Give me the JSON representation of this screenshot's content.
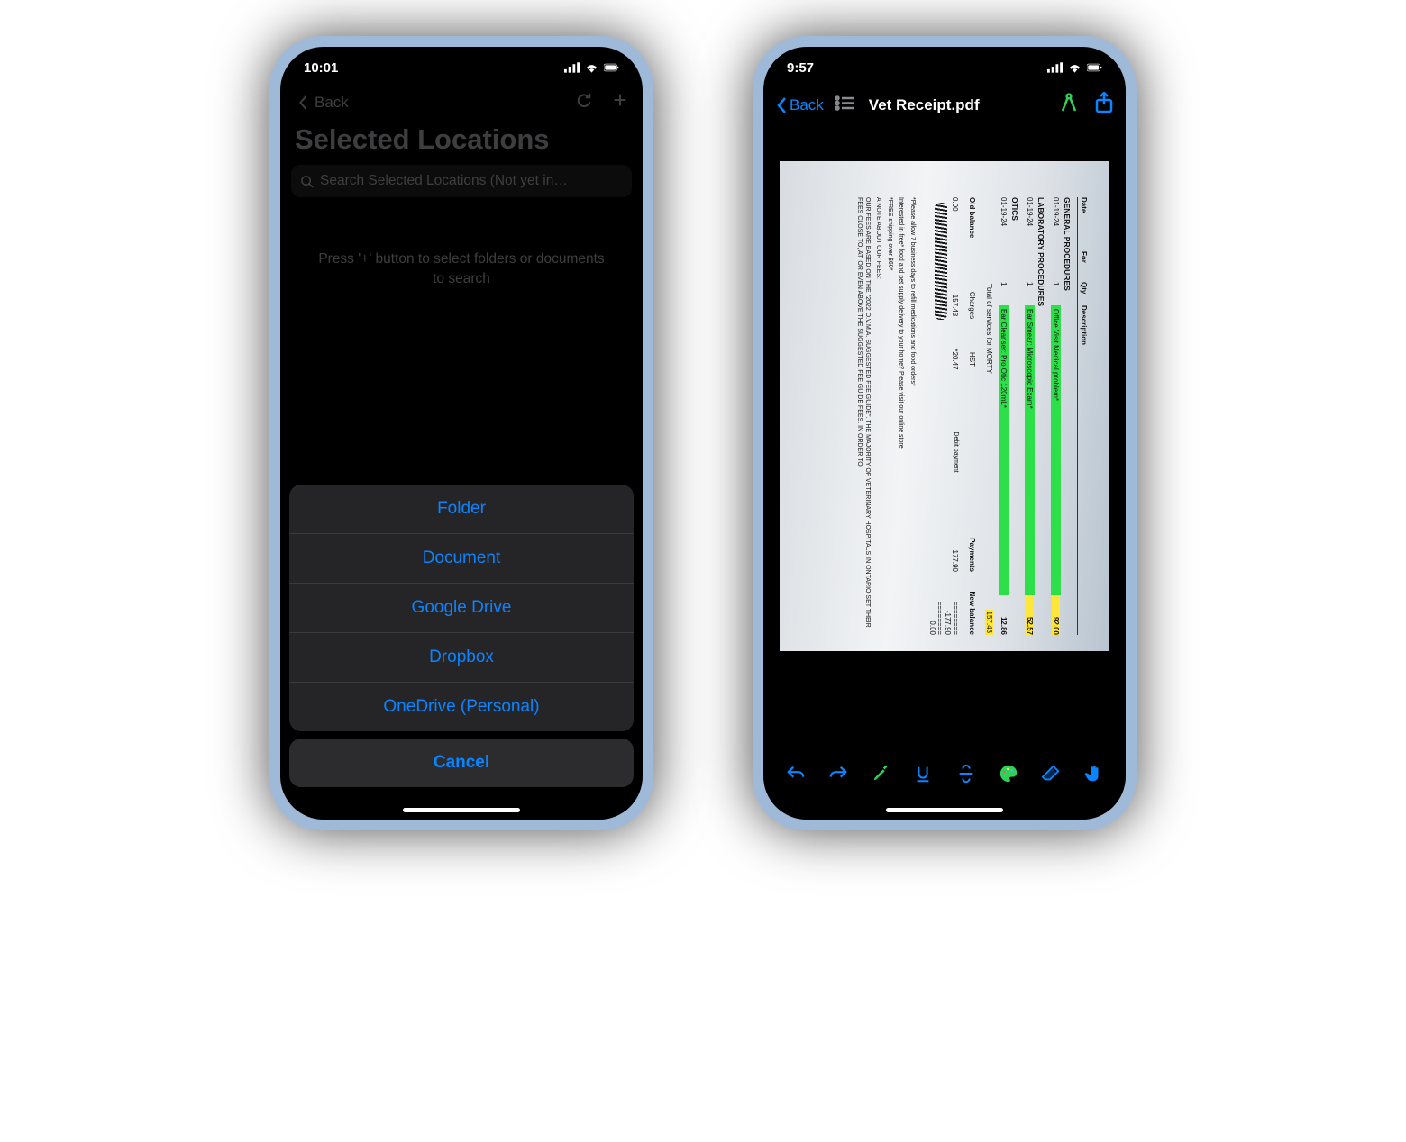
{
  "left": {
    "status": {
      "time": "10:01"
    },
    "nav": {
      "back": "Back"
    },
    "title": "Selected Locations",
    "search": {
      "placeholder": "Search Selected Locations  (Not yet in…"
    },
    "hint": "Press '+' button to select folders or documents to search",
    "sheet": {
      "items": [
        "Folder",
        "Document",
        "Google Drive",
        "Dropbox",
        "OneDrive (Personal)"
      ],
      "cancel": "Cancel"
    }
  },
  "right": {
    "status": {
      "time": "9:57"
    },
    "nav": {
      "back": "Back",
      "title": "Vet Receipt.pdf"
    },
    "receipt": {
      "header": [
        "Date",
        "For",
        "Qty",
        "Description"
      ],
      "sections": [
        {
          "title": "GENERAL PROCEDURES",
          "rows": [
            {
              "date": "01-19-24",
              "for": "",
              "qty": "1",
              "desc": "Office Visit Medical problem*",
              "amt": "92.00",
              "hl": "g",
              "amtHl": "y"
            }
          ]
        },
        {
          "title": "LABORATORY PROCEDURES",
          "rows": [
            {
              "date": "01-19-24",
              "for": "",
              "qty": "1",
              "desc": "Ear Smear: Microscopic Exam*",
              "amt": "52.57",
              "hl": "g",
              "amtHl": "y"
            }
          ]
        },
        {
          "title": "OTICS",
          "rows": [
            {
              "date": "01-19-24",
              "for": "",
              "qty": "1",
              "desc": "Ear Cleanser: Pro Otic 120mL*",
              "amt": "12.86",
              "hl": "g",
              "amtHl": ""
            }
          ]
        }
      ],
      "subtotal": {
        "label": "Total of services for MORTY",
        "amt": "157.43",
        "amtHl": "y"
      },
      "totals": [
        {
          "l": "Old balance",
          "c": "Charges",
          "r": "HST"
        },
        {
          "l": "0.00",
          "c": "157.43",
          "r": "*20.47"
        }
      ],
      "payments": {
        "label": "Payments",
        "value": "177.90",
        "method": "Debit payment"
      },
      "newBalance": {
        "label": "New balance",
        "lines": [
          "========",
          "-177.90",
          "========",
          "0.00"
        ]
      },
      "notes": [
        "*Please allow 7 business days to refill medications and food orders*",
        "Interested in free* food and pet supply delivery to your home? Please visit our online store",
        "*FREE shipping over $60*",
        "A NOTE ABOUT OUR FEES:",
        "OUR FEES ARE BASED ON THE \"2022 O.V.M.A. SUGGESTED FEE GUIDE\". THE MAJORITY OF VETERINARY HOSPITALS IN ONTARIO SET THEIR FEES CLOSE TO, AT, OR EVEN ABOVE THE SUGGESTED FEE GUIDE FEES. IN ORDER TO"
      ]
    }
  }
}
